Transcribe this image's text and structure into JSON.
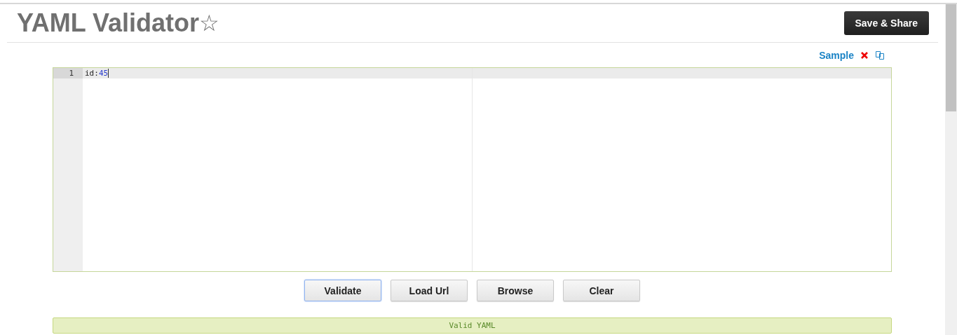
{
  "header": {
    "title": "YAML Validator",
    "star": "☆",
    "save_button": "Save & Share"
  },
  "toolbar": {
    "sample_link": "Sample"
  },
  "editor": {
    "lines": [
      {
        "number": "1",
        "key": "id:",
        "value": "45",
        "active": true
      }
    ]
  },
  "buttons": [
    {
      "label": "Validate",
      "focused": true
    },
    {
      "label": "Load Url",
      "focused": false
    },
    {
      "label": "Browse",
      "focused": false
    },
    {
      "label": "Clear",
      "focused": false
    }
  ],
  "status": {
    "message": "Valid YAML"
  }
}
